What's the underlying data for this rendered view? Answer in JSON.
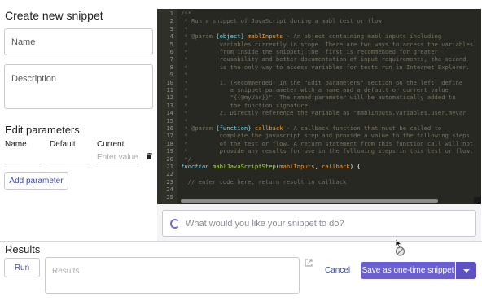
{
  "left": {
    "title": "Create new snippet",
    "name_placeholder": "Name",
    "description_placeholder": "Description",
    "params_title": "Edit parameters",
    "col_name": "Name",
    "col_default": "Default",
    "col_current": "Current",
    "current_placeholder": "Enter value",
    "add_param_label": "Add parameter"
  },
  "editor": {
    "lines": [
      {
        "n": "1",
        "parts": [
          {
            "c": "cm",
            "t": "/**"
          }
        ]
      },
      {
        "n": "2",
        "parts": [
          {
            "c": "cm",
            "t": " * Run a snippet of JavaScript during a mabl test or flow"
          }
        ]
      },
      {
        "n": "3",
        "parts": [
          {
            "c": "cm",
            "t": " *"
          }
        ]
      },
      {
        "n": "4",
        "parts": [
          {
            "c": "cm",
            "t": " * @param "
          },
          {
            "c": "ty",
            "t": "{object}"
          },
          {
            "c": "cm",
            "t": " "
          },
          {
            "c": "pn",
            "t": "mablInputs"
          },
          {
            "c": "cm",
            "t": " - An object containing mabl inputs including"
          }
        ]
      },
      {
        "n": "5",
        "parts": [
          {
            "c": "cm",
            "t": " *         variables currently in scope. There are two ways to access the variables"
          }
        ]
      },
      {
        "n": "6",
        "parts": [
          {
            "c": "cm",
            "t": " *         from inside the snippet; the  first is recommended for greater"
          }
        ]
      },
      {
        "n": "7",
        "parts": [
          {
            "c": "cm",
            "t": " *         reusability and better documentation of input requirements, the second"
          }
        ]
      },
      {
        "n": "8",
        "parts": [
          {
            "c": "cm",
            "t": " *         is the only way to access variables for tests run in Internet Explorer."
          }
        ]
      },
      {
        "n": "9",
        "parts": [
          {
            "c": "cm",
            "t": " *"
          }
        ]
      },
      {
        "n": "10",
        "parts": [
          {
            "c": "cm",
            "t": " *         1. (Recommended) In the \"Edit parameters\" section on the left, define"
          }
        ]
      },
      {
        "n": "11",
        "parts": [
          {
            "c": "cm",
            "t": " *            a snippet parameter with a name and a default or current value"
          }
        ]
      },
      {
        "n": "12",
        "parts": [
          {
            "c": "cm",
            "t": " *            \"{{@myVar}}\". The named parameter will be automatically added to"
          }
        ]
      },
      {
        "n": "13",
        "parts": [
          {
            "c": "cm",
            "t": " *            the function signature."
          }
        ]
      },
      {
        "n": "14",
        "parts": [
          {
            "c": "cm",
            "t": " *         2. Directly reference the variable as \"mablInputs.variables.user.myVar"
          }
        ]
      },
      {
        "n": "15",
        "parts": [
          {
            "c": "cm",
            "t": " *"
          }
        ]
      },
      {
        "n": "16",
        "parts": [
          {
            "c": "cm",
            "t": " * @param "
          },
          {
            "c": "ty",
            "t": "{function}"
          },
          {
            "c": "cm",
            "t": " "
          },
          {
            "c": "pn",
            "t": "callback"
          },
          {
            "c": "cm",
            "t": " - A callback function that must be called to"
          }
        ]
      },
      {
        "n": "17",
        "parts": [
          {
            "c": "cm",
            "t": " *         complete the javascript step and provide a value to the following steps"
          }
        ]
      },
      {
        "n": "18",
        "parts": [
          {
            "c": "cm",
            "t": " *         of the test or flow. A return statement from this function call will not"
          }
        ]
      },
      {
        "n": "19",
        "parts": [
          {
            "c": "cm",
            "t": " *         provide any results for use in the following steps in this test or flow."
          }
        ]
      },
      {
        "n": "20",
        "parts": [
          {
            "c": "cm",
            "t": " */"
          }
        ]
      },
      {
        "n": "21",
        "parts": [
          {
            "c": "kw",
            "t": "function"
          },
          {
            "c": "tx",
            "t": " "
          },
          {
            "c": "fn",
            "t": "mablJavaScriptStep"
          },
          {
            "c": "tx",
            "t": "("
          },
          {
            "c": "pn",
            "t": "mablInputs"
          },
          {
            "c": "tx",
            "t": ", "
          },
          {
            "c": "pn",
            "t": "callback"
          },
          {
            "c": "tx",
            "t": ") {"
          }
        ]
      },
      {
        "n": "22",
        "parts": [
          {
            "c": "tx",
            "t": ""
          }
        ]
      },
      {
        "n": "23",
        "parts": [
          {
            "c": "cm",
            "t": "  // enter code here, return result in callback"
          }
        ]
      },
      {
        "n": "24",
        "parts": [
          {
            "c": "tx",
            "t": ""
          }
        ]
      },
      {
        "n": "25",
        "parts": [
          {
            "c": "tx",
            "t": ""
          }
        ]
      }
    ]
  },
  "ai": {
    "placeholder": "What would you like your snippet to do?",
    "icon": "sparkle-loader-icon"
  },
  "bottom": {
    "results_title": "Results",
    "run_label": "Run",
    "results_placeholder": "Results",
    "cancel_label": "Cancel",
    "save_label": "Save as one-time snippet"
  },
  "colors": {
    "accent": "#6b5fd3",
    "link": "#3a49b6",
    "editor_bg": "#272822"
  }
}
